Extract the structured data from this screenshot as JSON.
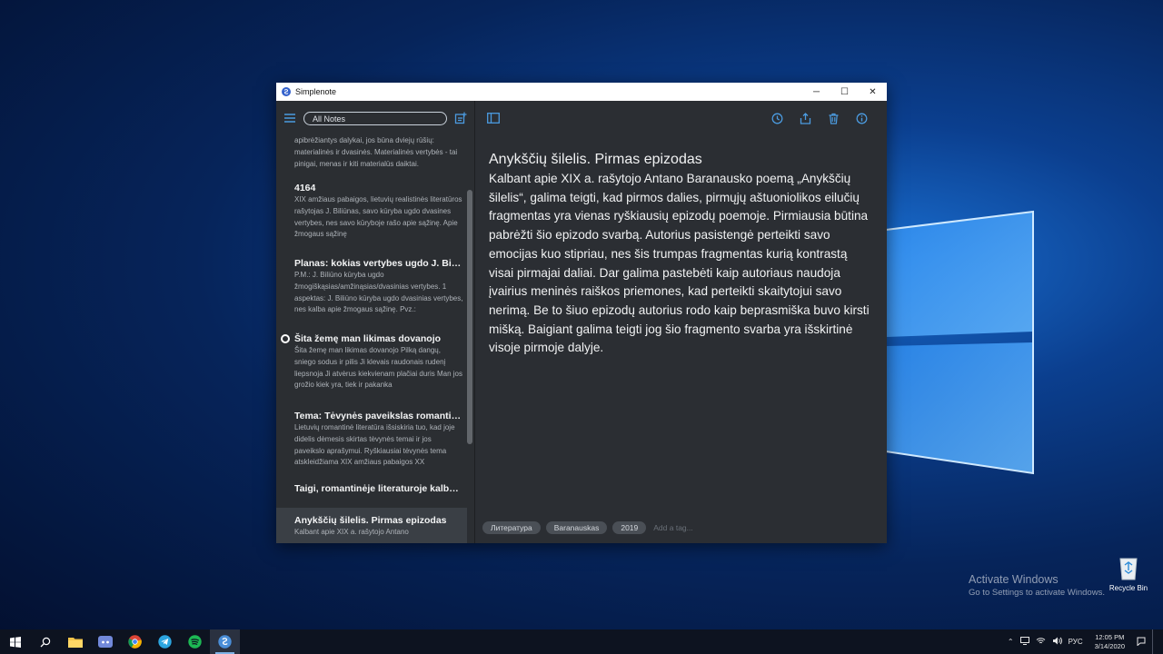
{
  "window": {
    "title": "Simplenote",
    "controls": {
      "minimize": "─",
      "maximize": "☐",
      "close": "✕"
    }
  },
  "sidebar": {
    "search_label": "All Notes",
    "notes": [
      {
        "title": "",
        "preview": "apibrėžiantys dalykai, jos būna dviejų rūšių: materialinės ir dvasinės. Materialinės vertybės - tai pinigai, menas ir kiti materialūs daiktai.",
        "pinned": false,
        "selected": false
      },
      {
        "title": "4164",
        "preview": "XIX amžiaus pabaigos, lietuvių realistinės literatūros rašytojas J. Biliūnas, savo kūryba ugdo dvasines vertybes, nes savo kūryboje rašo apie sąžinę. Apie žmogaus sąžinę",
        "pinned": false,
        "selected": false
      },
      {
        "title": "Planas: kokias vertybes ugdo J. Biliūno kūryba?",
        "preview": "P.M.: J. Biliūno kūryba ugdo žmogiškąsias/amžinąsias/dvasinias vertybes. 1 aspektas: J. Biliūno kūryba ugdo dvasinias vertybes, nes kalba apie žmogaus sąžinę. Pvz.:",
        "pinned": false,
        "selected": false
      },
      {
        "title": "Šita žemę man likimas dovanojo",
        "preview": "Šita žemę man likimas dovanojo Pilką dangų, sniego sodus ir pilis Ji klevais raudonais rudenį liepsnoja Ji atvėrus kiekvienam plačiai duris Man jos grožio kiek yra, tiek ir pakanka",
        "pinned": true,
        "selected": false
      },
      {
        "title": "Tema: Tėvynės paveikslas romantinėje literatūroje",
        "preview": "Lietuvių romantinė literatūra išsiskiria tuo, kad joje didelis dėmesis skirtas tėvynės temai ir jos paveikslo aprašymui. Ryškiausiai tėvynės tema atskleidžiama XIX amžiaus pabaigos XX",
        "pinned": false,
        "selected": false
      },
      {
        "title": "Taigi, romantinėje literaturoje kalbama apie",
        "preview": "",
        "pinned": false,
        "selected": false
      },
      {
        "title": "Anykščių šilelis. Pirmas epizodas",
        "preview": "Kalbant apie XIX a. rašytojo Antano",
        "pinned": false,
        "selected": true
      }
    ]
  },
  "editor": {
    "title": "Anykščių šilelis. Pirmas epizodas",
    "body": "Kalbant apie XIX a. rašytojo Antano Baranausko poemą „Anykščių šilelis“,  galima teigti, kad pirmos dalies, pirmųjų aštuoniolikos eilučių fragmentas yra vienas ryškiausių epizodų poemoje. Pirmiausia būtina pabrėžti šio epizodo svarbą. Autorius pasistengė perteikti savo emocijas kuo stipriau, nes šis trumpas fragmentas kurią kontrastą visai pirmajai daliai. Dar galima pastebėti kaip autoriaus naudoja įvairius meninės raiškos priemones, kad perteikti skaitytojui savo nerimą. Be to šiuo epizodų autorius rodo kaip beprasmiška buvo kirsti mišką. Baigiant galima teigti jog šio fragmento svarba yra išskirtinė visoje pirmoje dalyje.",
    "tags": [
      "Литература",
      "Baranauskas",
      "2019"
    ],
    "tag_placeholder": "Add a tag..."
  },
  "desktop": {
    "watermark_line1": "Activate Windows",
    "watermark_line2": "Go to Settings to activate Windows.",
    "recycle_bin_label": "Recycle Bin"
  },
  "taskbar": {
    "apps": [
      "start-icon",
      "search-icon",
      "file-explorer-icon",
      "discord-icon",
      "chrome-icon",
      "telegram-icon",
      "spotify-icon",
      "simplenote-icon"
    ],
    "language": "РУС",
    "time": "12:05 PM",
    "date": "3/14/2020"
  },
  "colors": {
    "accent": "#4b9be0",
    "editor_bg": "#2b2e33",
    "sidebar_bg": "#2b2e32"
  }
}
